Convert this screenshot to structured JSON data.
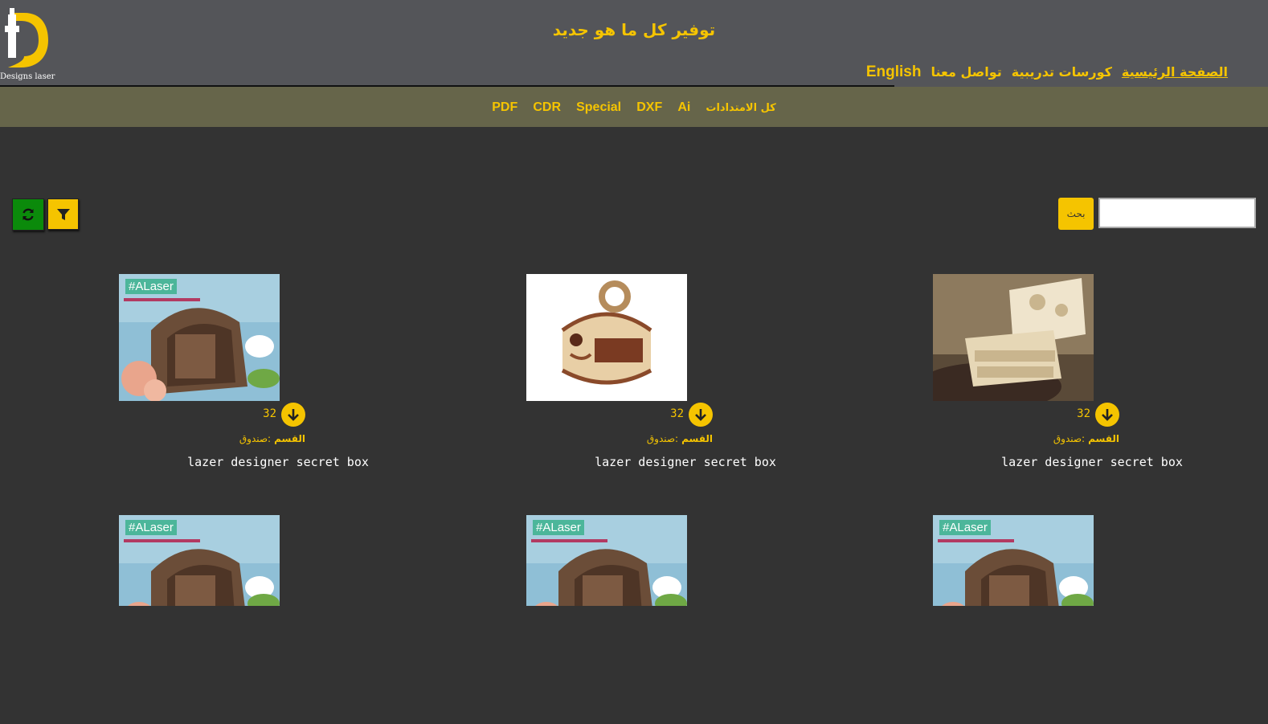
{
  "header": {
    "logo_text": "Designs laser",
    "site_title": "توفير كل ما هو جديد",
    "nav": [
      {
        "label": "الصفحة الرئيسية",
        "active": true
      },
      {
        "label": "كورسات تدريبية",
        "active": false
      },
      {
        "label": "تواصل معنا",
        "active": false
      },
      {
        "label": "English",
        "active": false
      }
    ]
  },
  "extensions": {
    "all": "كل الامتدادات",
    "items": [
      "PDF",
      "CDR",
      "Special",
      "DXF",
      "Ai"
    ]
  },
  "search": {
    "placeholder": "",
    "button_label": "بحث"
  },
  "toolbar": {
    "filter_icon": "filter-icon",
    "refresh_icon": "refresh-icon"
  },
  "colors": {
    "accent": "#f5c400",
    "header_bg": "#545559",
    "ext_bar_bg": "#66654a",
    "page_bg": "#333333",
    "refresh_bg": "#0b8a0b"
  },
  "cards": [
    {
      "image": "secret-box-alaser",
      "tag": "#ALaser",
      "downloads": "32",
      "category_label": "القسم",
      "category_value": ":صندوق",
      "title": "lazer designer secret box"
    },
    {
      "image": "wooden-lantern-box",
      "tag": "",
      "downloads": "32",
      "category_label": "القسم",
      "category_value": ":صندوق",
      "title": "lazer designer secret box"
    },
    {
      "image": "drawer-jewelry-box",
      "tag": "",
      "downloads": "32",
      "category_label": "القسم",
      "category_value": ":صندوق",
      "title": "lazer designer secret box"
    },
    {
      "image": "secret-box-alaser",
      "tag": "#ALaser",
      "downloads": "",
      "category_label": "",
      "category_value": "",
      "title": ""
    },
    {
      "image": "secret-box-alaser",
      "tag": "#ALaser",
      "downloads": "",
      "category_label": "",
      "category_value": "",
      "title": ""
    },
    {
      "image": "secret-box-alaser",
      "tag": "#ALaser",
      "downloads": "",
      "category_label": "",
      "category_value": "",
      "title": ""
    }
  ]
}
